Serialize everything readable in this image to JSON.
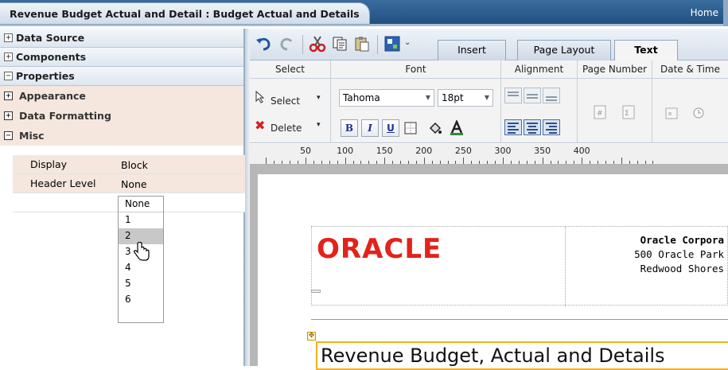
{
  "title_tab": "Revenue Budget Actual and Detail : Budget Actual and Details",
  "home_link": "Home",
  "left_panel": {
    "sections": [
      {
        "label": "Data Source",
        "toggle": "+"
      },
      {
        "label": "Components",
        "toggle": "+"
      },
      {
        "label": "Properties",
        "toggle": "−"
      }
    ],
    "subsections": [
      {
        "label": "Appearance",
        "toggle": "+"
      },
      {
        "label": "Data Formatting",
        "toggle": "+"
      },
      {
        "label": "Misc",
        "toggle": "−"
      }
    ],
    "properties": [
      {
        "key": "Display",
        "value": "Block"
      },
      {
        "key": "Header Level",
        "value": "None"
      }
    ],
    "header_level_options": [
      "None",
      "1",
      "2",
      "3",
      "4",
      "5",
      "6"
    ],
    "highlighted_option": "2"
  },
  "toolbar": {
    "tabs": [
      {
        "label": "Insert",
        "active": false
      },
      {
        "label": "Page Layout",
        "active": false
      },
      {
        "label": "Text",
        "active": true
      }
    ]
  },
  "ribbon": {
    "select_group": {
      "title": "Select",
      "select_label": "Select",
      "delete_label": "Delete"
    },
    "font_group": {
      "title": "Font",
      "font_name": "Tahoma",
      "font_size": "18pt",
      "bold": "B",
      "italic": "I",
      "underline": "U"
    },
    "alignment_group": {
      "title": "Alignment"
    },
    "page_number_group": {
      "title": "Page Number"
    },
    "date_time_group": {
      "title": "Date & Time"
    }
  },
  "ruler": {
    "labels": [
      "50",
      "100",
      "150",
      "200",
      "250",
      "300",
      "350",
      "400"
    ]
  },
  "document": {
    "logo_text": "ORACLE",
    "company_name": "Oracle Corpora",
    "address_line1": "500 Oracle Park",
    "address_line2": "Redwood Shores",
    "report_title": "Revenue Budget, Actual and Details"
  },
  "colors": {
    "accent_red": "#e2231a",
    "selection_border": "#f0b21a",
    "titlebar_blue": "#2b5b8a"
  }
}
